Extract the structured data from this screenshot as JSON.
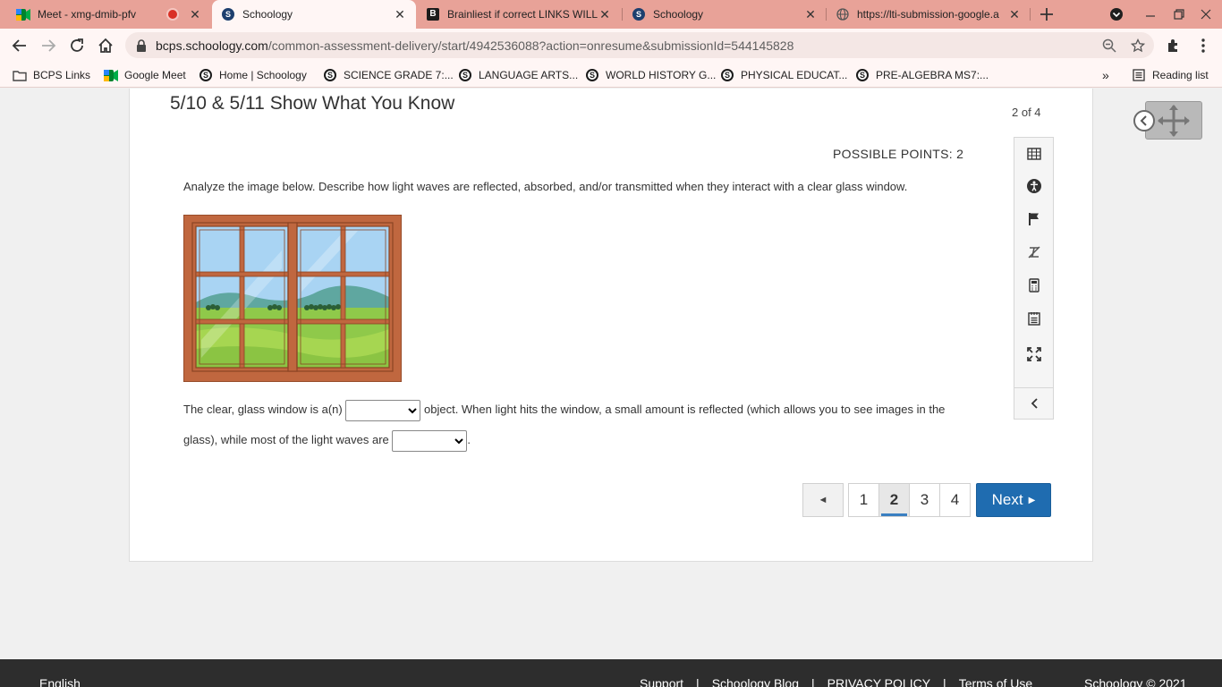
{
  "browser": {
    "tabs": [
      {
        "title": "Meet - xmg-dmib-pfv",
        "recording": true
      },
      {
        "title": "Schoology",
        "active": true
      },
      {
        "title": "Brainliest if correct LINKS WILL"
      },
      {
        "title": "Schoology"
      },
      {
        "title": "https://lti-submission-google.a"
      }
    ],
    "address": {
      "host": "bcps.schoology.com",
      "path": "/common-assessment-delivery/start/4942536088?action=onresume&submissionId=544145828"
    },
    "bookmarks": [
      "BCPS Links",
      "Google Meet",
      "Home | Schoology",
      "SCIENCE GRADE 7:...",
      "LANGUAGE ARTS...",
      "WORLD HISTORY G...",
      "PHYSICAL EDUCAT...",
      "PRE-ALGEBRA MS7:..."
    ],
    "reading_list": "Reading list",
    "colors": {
      "tabbar": "#e8a298",
      "toolbar": "#fff6f5"
    }
  },
  "assessment": {
    "title": "5/10 & 5/11 Show What You Know",
    "progress": "2 of 4",
    "points": "POSSIBLE POINTS: 2",
    "prompt": "Analyze the image below.  Describe how light waves are reflected, absorbed, and/or transmitted when they interact with a clear glass window.",
    "answer": {
      "part1": "The clear, glass window is a(n)",
      "part2": "object.  When light hits the window, a small amount is reflected (which allows you to see images in the glass), while most of the light waves are",
      "part3": ".",
      "dropdown1_value": "",
      "dropdown2_value": ""
    },
    "tools": [
      "calculator-grid-icon",
      "accessibility-icon",
      "flag-icon",
      "line-reader-icon",
      "calculator-icon",
      "notepad-icon",
      "fullscreen-icon",
      "collapse-left-icon"
    ],
    "pager": {
      "prev": "◄",
      "pages": [
        "1",
        "2",
        "3",
        "4"
      ],
      "current": "2",
      "next": "Next"
    },
    "accent_color": "#1f6cb0"
  },
  "footer": {
    "language": "English",
    "links": [
      "Support",
      "Schoology Blog",
      "PRIVACY POLICY",
      "Terms of Use"
    ],
    "separator": "|",
    "copyright": "Schoology © 2021"
  }
}
